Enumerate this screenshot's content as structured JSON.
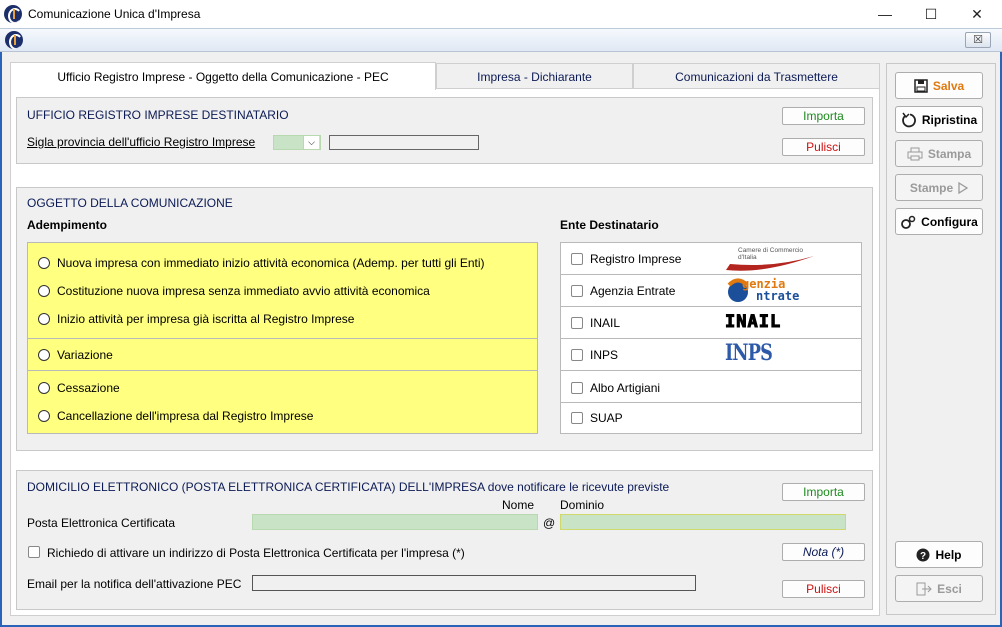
{
  "window": {
    "title": "Comunicazione Unica d'Impresa",
    "minimize": "—",
    "maximize": "☐",
    "close": "✕",
    "mdi_close": "☒"
  },
  "tabs": [
    {
      "label": "Ufficio Registro Imprese - Oggetto della Comunicazione - PEC"
    },
    {
      "label": "Impresa - Dichiarante"
    },
    {
      "label": "Comunicazioni da Trasmettere"
    }
  ],
  "registro": {
    "title": "UFFICIO REGISTRO IMPRESE DESTINATARIO",
    "sigla_label": "Sigla provincia dell'ufficio Registro Imprese",
    "importa": "Importa",
    "pulisci": "Pulisci"
  },
  "oggetto": {
    "title": "OGGETTO DELLA COMUNICAZIONE",
    "adempimento_label": "Adempimento",
    "ente_label": "Ente Destinatario",
    "options": [
      "Nuova impresa con immediato inizio attività economica (Ademp. per tutti gli Enti)",
      "Costituzione nuova impresa senza immediato avvio attività economica",
      "Inizio attività per impresa già iscritta al Registro Imprese",
      "Variazione",
      "Cessazione",
      "Cancellazione dell'impresa dal Registro Imprese"
    ],
    "enti": [
      "Registro Imprese",
      "Agenzia Entrate",
      "INAIL",
      "INPS",
      "Albo Artigiani",
      "SUAP"
    ],
    "logos": {
      "camere": "Camere di Commercio\nd'Italia",
      "agenzia_a": "genzia",
      "agenzia_b": "ntrate",
      "inail": "INAIL",
      "inps": "INPS"
    }
  },
  "pec": {
    "title": "DOMICILIO ELETTRONICO (POSTA ELETTRONICA CERTIFICATA) DELL'IMPRESA dove notificare le ricevute previste",
    "nome_label": "Nome",
    "dominio_label": "Dominio",
    "pec_label": "Posta Elettronica Certificata",
    "at": "@",
    "richiedo_label": "Richiedo di attivare un indirizzo di Posta Elettronica Certificata per l'impresa (*)",
    "email_label": "Email per la notifica dell'attivazione PEC",
    "importa": "Importa",
    "nota": "Nota (*)",
    "pulisci": "Pulisci"
  },
  "side": {
    "salva": "Salva",
    "ripristina": "Ripristina",
    "stampa": "Stampa",
    "stampe": "Stampe",
    "configura": "Configura",
    "help": "Help",
    "esci": "Esci"
  },
  "colors": {
    "yellow": "#ffff80",
    "field_green": "#c9e3c6",
    "title_navy": "#0b1a55",
    "frame_blue": "#2a64b8"
  }
}
